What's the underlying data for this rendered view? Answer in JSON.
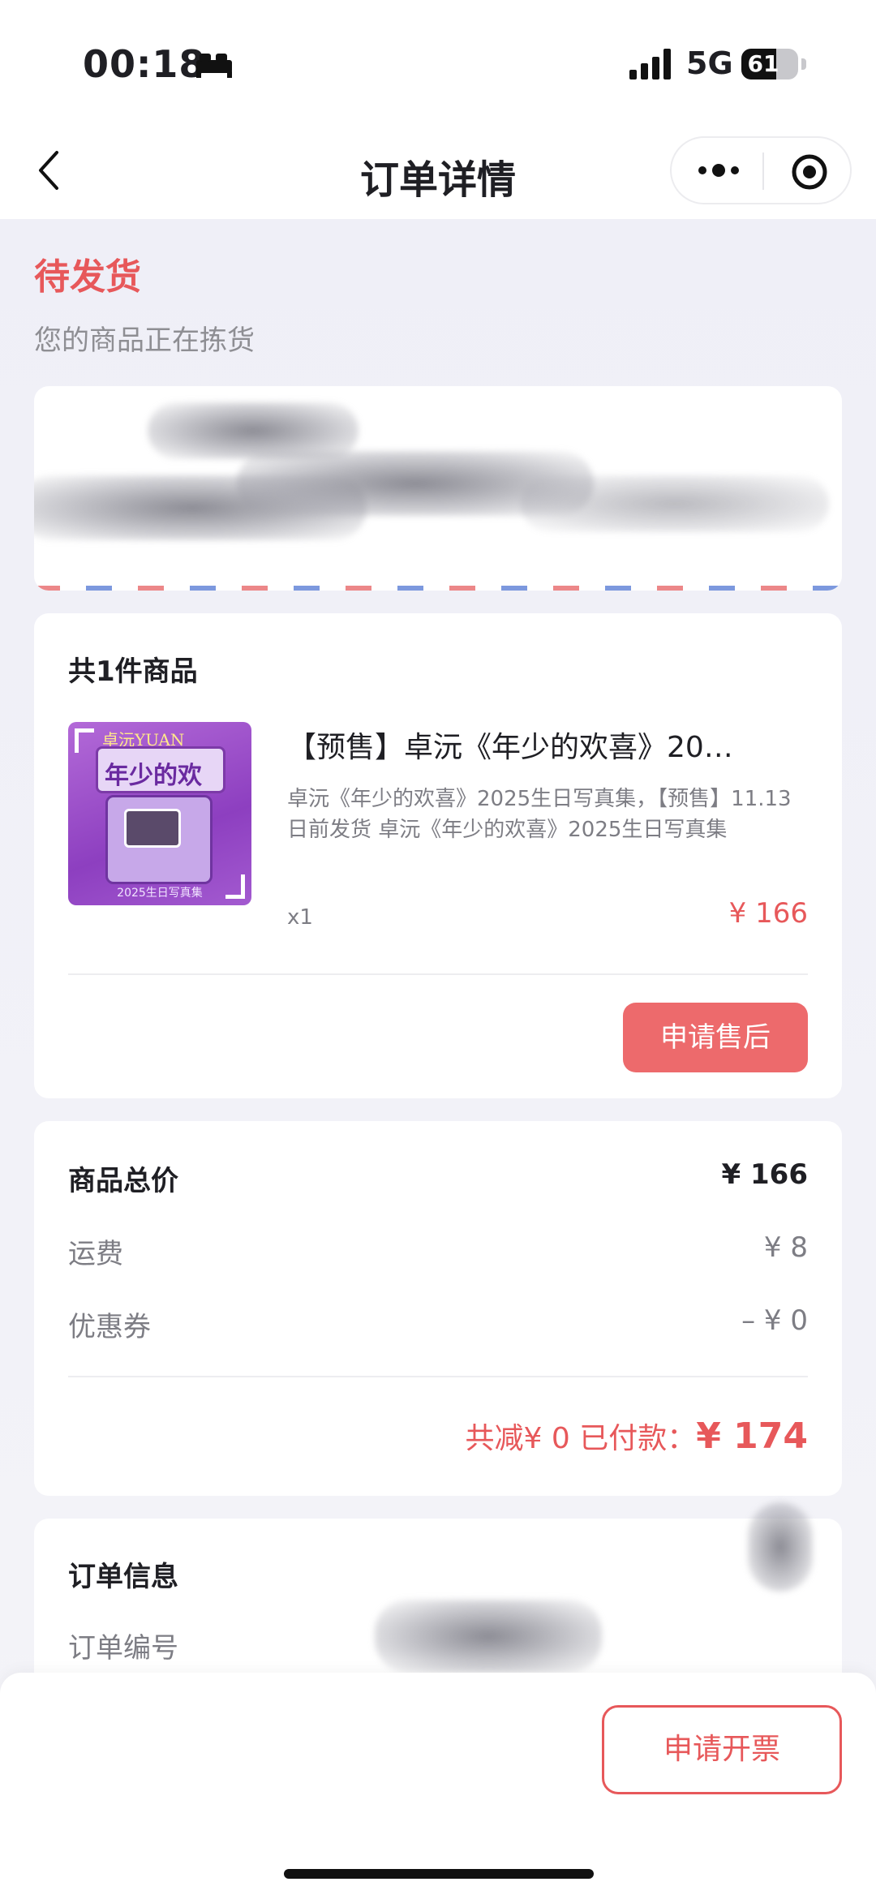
{
  "status_bar": {
    "time": "00:18",
    "network": "5G",
    "battery": "61",
    "battery_level": 0.61
  },
  "nav": {
    "title": "订单详情",
    "icons": [
      "back-icon",
      "more-icon",
      "target-icon"
    ]
  },
  "order_status": {
    "title": "待发货",
    "subtitle": "您的商品正在拣货"
  },
  "product_card": {
    "count_label": "共1件商品",
    "thumbnail": {
      "brand": "卓沅YUAN",
      "title": "年少的欢喜",
      "footer": "2025生日写真集"
    },
    "name": "【预售】卓沅《年少的欢喜》20…",
    "description": "卓沅《年少的欢喜》2025生日写真集，【预售】11.13日前发货 卓沅《年少的欢喜》2025生日写真集",
    "quantity": "x1",
    "price": "¥ 166",
    "aftersale_button": "申请售后"
  },
  "price_card": {
    "rows": [
      {
        "label": "商品总价",
        "value": "¥ 166"
      },
      {
        "label": "运费",
        "value": "¥ 8"
      },
      {
        "label": "优惠券",
        "value": "– ¥ 0"
      }
    ],
    "total_prefix": "共减¥ 0  已付款：",
    "total_amount": "¥ 174"
  },
  "order_info": {
    "title": "订单信息",
    "order_number_label": "订单编号"
  },
  "bottom_bar": {
    "invoice_button": "申请开票"
  },
  "colors": {
    "accent": "#e7585a",
    "button_fill": "#ed6a6c",
    "muted_text": "#7d7d84",
    "background": "#f3f3f8"
  }
}
